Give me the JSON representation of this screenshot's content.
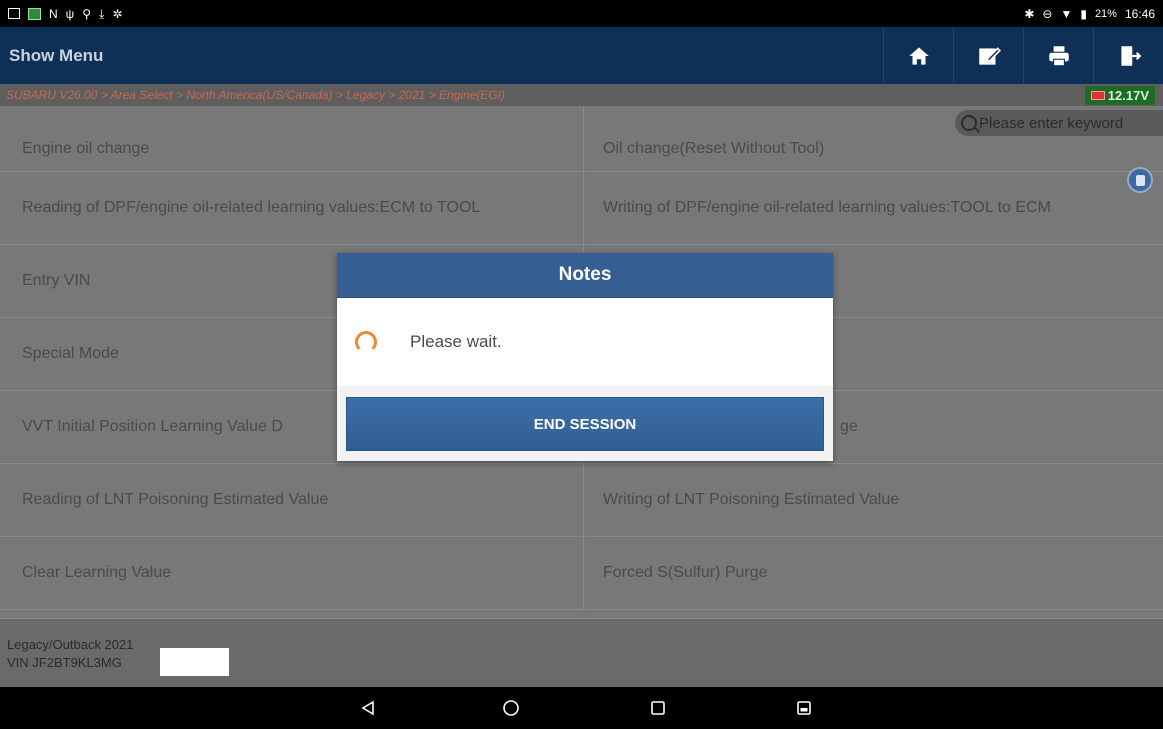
{
  "statusbar": {
    "left_icons": [
      "gallery-icon",
      "app-icon",
      "n-icon",
      "usb-icon",
      "debug-icon",
      "download-icon",
      "settings-icon"
    ],
    "right_text": "21%",
    "time": "16:46"
  },
  "header": {
    "title": "Show Menu",
    "buttons": [
      "home-icon",
      "edit-icon",
      "print-icon",
      "exit-icon"
    ]
  },
  "breadcrumb": "SUBARU V26.00 > Area Select > North America(US/Canada) > Legacy > 2021 > Engine(EGI)",
  "battery": "12.17V",
  "search": {
    "placeholder": "Please enter keyword"
  },
  "menu": {
    "rows": [
      {
        "left": "Engine oil change",
        "right": "Oil change(Reset Without Tool)"
      },
      {
        "left": "Reading of DPF/engine oil-related learning values:ECM to TOOL",
        "right": "Writing of DPF/engine oil-related learning values:TOOL to ECM"
      },
      {
        "left": "Entry VIN",
        "right": ""
      },
      {
        "left": "Special Mode",
        "right": ""
      },
      {
        "left": "VVT Initial Position Learning Value D",
        "right": "ge"
      },
      {
        "left": "Reading of LNT Poisoning Estimated Value",
        "right": "Writing of LNT Poisoning Estimated Value"
      },
      {
        "left": "Clear Learning Value",
        "right": "Forced S(Sulfur) Purge"
      }
    ]
  },
  "footer": {
    "model": "Legacy/Outback 2021",
    "vin": "VIN JF2BT9KL3MG"
  },
  "dialog": {
    "title": "Notes",
    "message": "Please wait.",
    "button": "END SESSION"
  },
  "colors": {
    "header_bg": "#0e2f56",
    "dialog_head": "#355f93",
    "spinner": "#ee8a2e",
    "breadcrumb_text": "#c66a51",
    "battery_bg": "#1d6b26"
  }
}
